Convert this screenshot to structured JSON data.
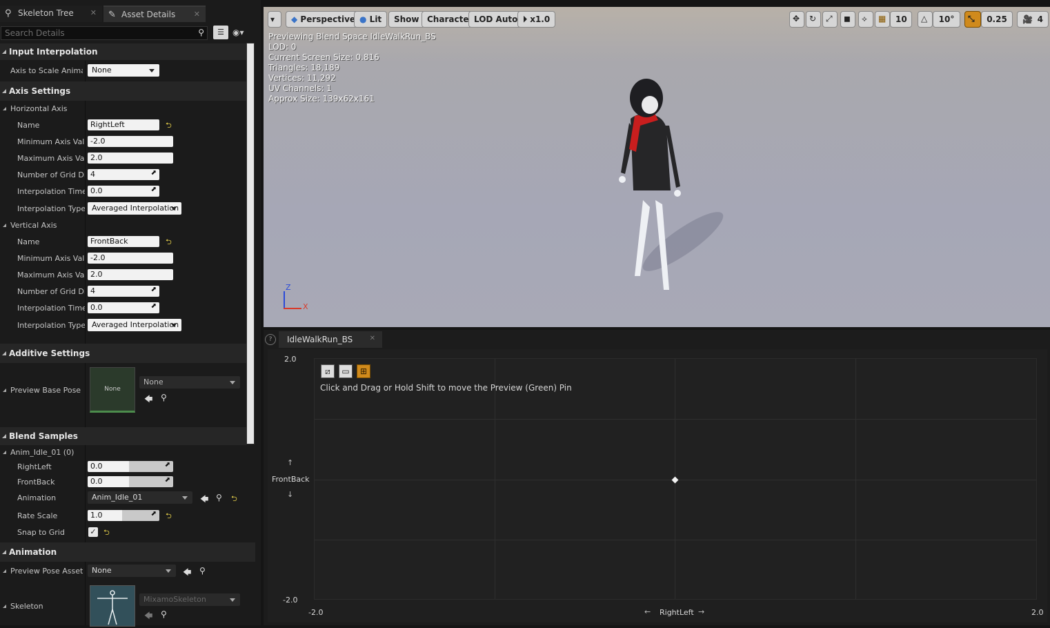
{
  "tabs": [
    {
      "label": "Skeleton Tree",
      "icon": "bone-icon"
    },
    {
      "label": "Asset Details",
      "icon": "asset-icon"
    }
  ],
  "search": {
    "placeholder": "Search Details"
  },
  "sections": {
    "input_interpolation": "Input Interpolation",
    "axis_settings": "Axis Settings",
    "additive_settings": "Additive Settings",
    "blend_samples": "Blend Samples",
    "animation": "Animation"
  },
  "input_interp": {
    "label": "Axis to Scale Animati",
    "value": "None"
  },
  "horizontal": {
    "title": "Horizontal Axis",
    "name_label": "Name",
    "name": "RightLeft",
    "min_label": "Minimum Axis Valu",
    "min": "-2.0",
    "max_label": "Maximum Axis Val",
    "max": "2.0",
    "grid_label": "Number of Grid Divi",
    "grid": "4",
    "itime_label": "Interpolation Time",
    "itime": "0.0",
    "itype_label": "Interpolation Type",
    "itype": "Averaged Interpolation"
  },
  "vertical": {
    "title": "Vertical Axis",
    "name_label": "Name",
    "name": "FrontBack",
    "min_label": "Minimum Axis Valu",
    "min": "-2.0",
    "max_label": "Maximum Axis Val",
    "max": "2.0",
    "grid_label": "Number of Grid Divi",
    "grid": "4",
    "itime_label": "Interpolation Time",
    "itime": "0.0",
    "itype_label": "Interpolation Type",
    "itype": "Averaged Interpolation"
  },
  "additive": {
    "label": "Preview Base Pose",
    "thumb": "None",
    "value": "None"
  },
  "sample": {
    "title": "Anim_Idle_01 (0)",
    "rl_label": "RightLeft",
    "rl": "0.0",
    "fb_label": "FrontBack",
    "fb": "0.0",
    "anim_label": "Animation",
    "anim": "Anim_Idle_01",
    "rate_label": "Rate Scale",
    "rate": "1.0",
    "snap_label": "Snap to Grid",
    "snap": true
  },
  "animation": {
    "pose_label": "Preview Pose Asset",
    "pose": "None",
    "skel_label": "Skeleton",
    "skel": "MixamoSkeleton"
  },
  "viewport": {
    "buttons": [
      "Perspective",
      "Lit",
      "Show",
      "Character",
      "LOD Auto",
      "x1.0"
    ],
    "right_values": {
      "grid": "10",
      "angle": "10°",
      "scale": "0.25",
      "speed": "4"
    },
    "stats": [
      "Previewing Blend Space IdleWalkRun_BS",
      "LOD: 0",
      "Current Screen Size: 0.816",
      "Triangles: 18,189",
      "Vertices: 11,292",
      "UV Channels: 1",
      "Approx Size: 139x62x161"
    ],
    "gizmo_z": "Z",
    "gizmo_x": "X"
  },
  "blend": {
    "tab": "IdleWalkRun_BS",
    "hint": "Click and Drag or Hold Shift to move the Preview (Green) Pin",
    "y_max": "2.0",
    "y_min": "-2.0",
    "y_label": "FrontBack",
    "x_min": "-2.0",
    "x_max": "2.0",
    "x_label": "RightLeft"
  },
  "colors": {
    "accent_orange": "#d08a1c",
    "reset_yellow": "#e6d04a",
    "scarf_red": "#c81e1e"
  }
}
